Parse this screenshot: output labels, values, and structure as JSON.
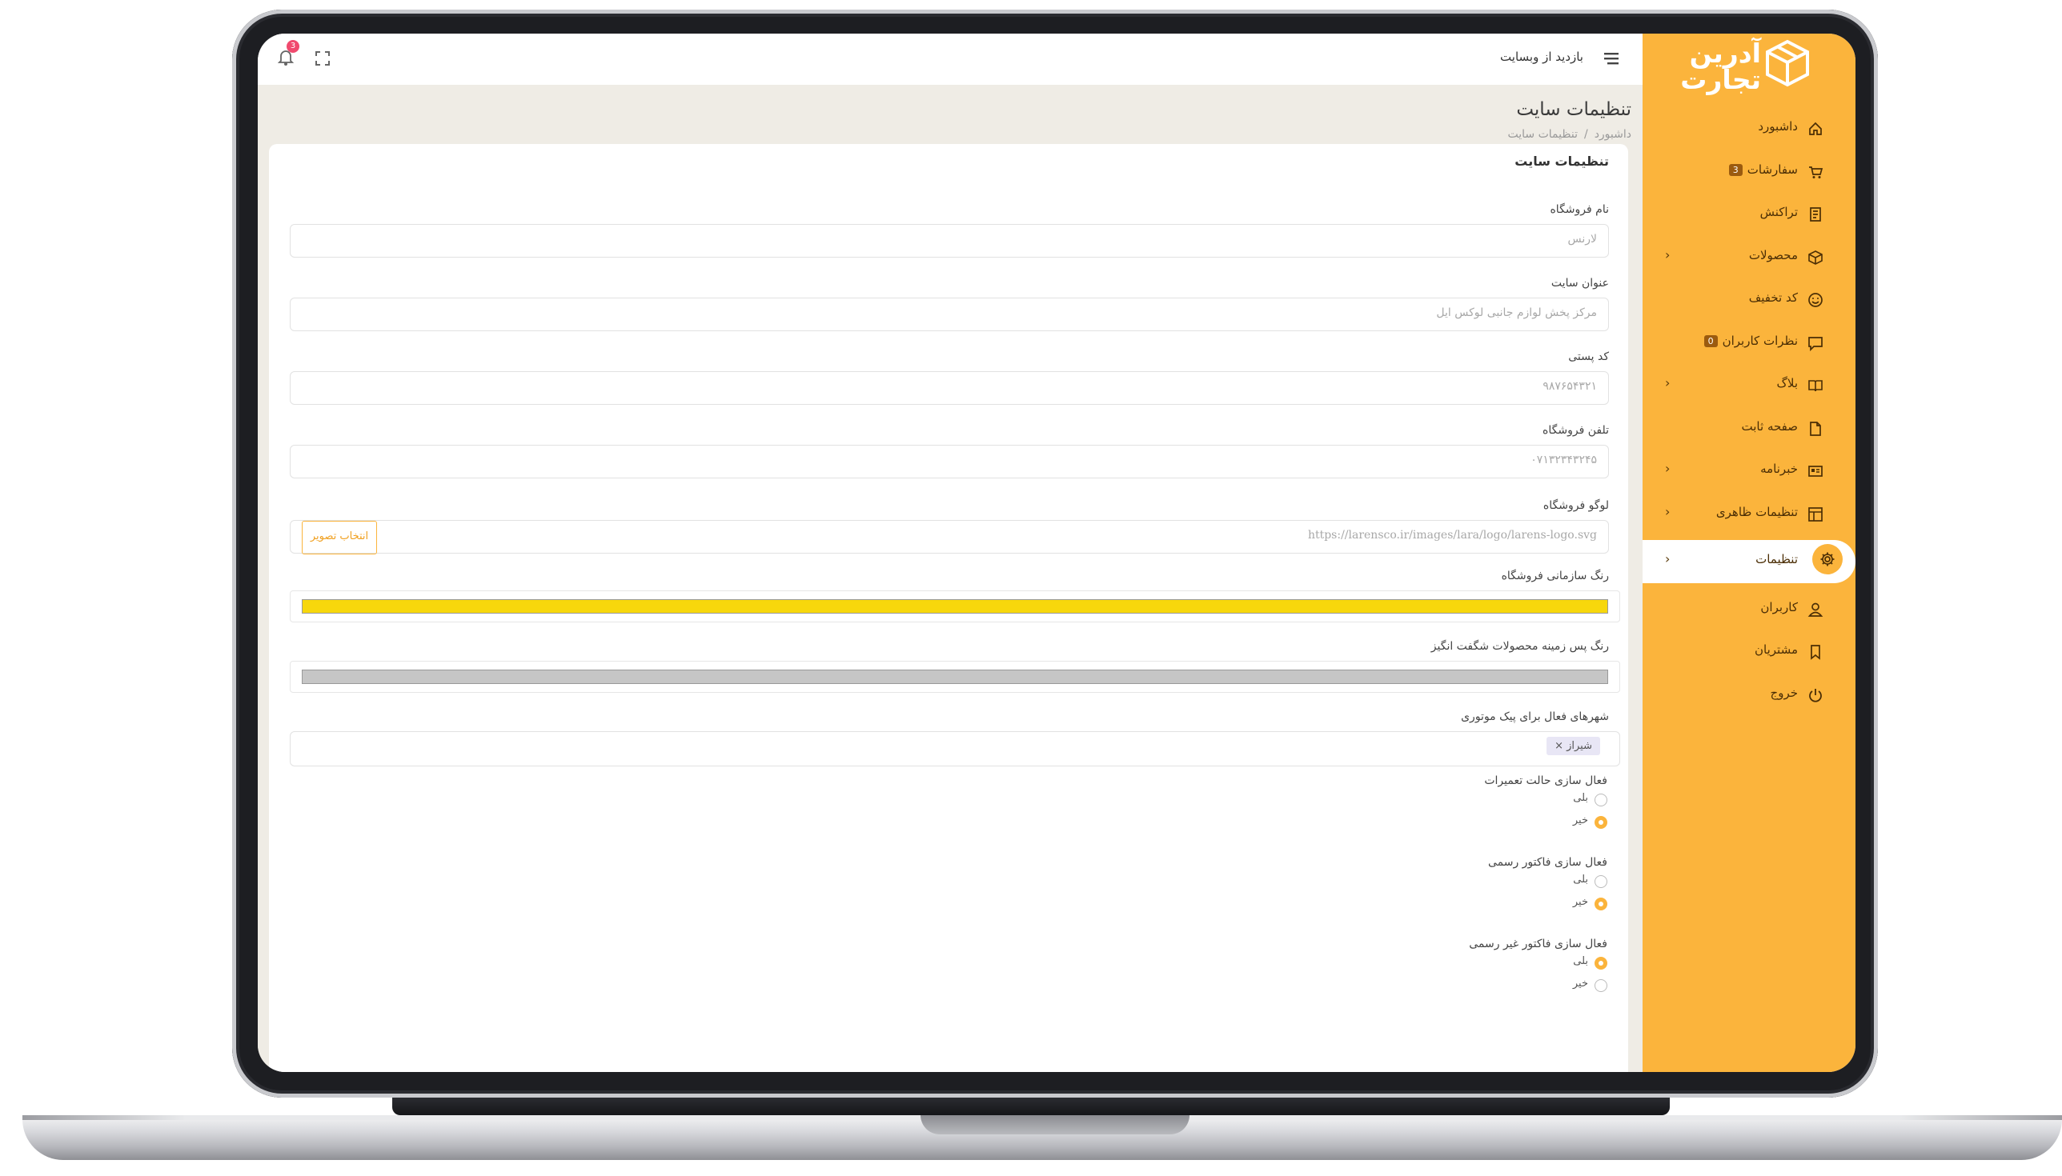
{
  "brand": {
    "name": "آدرین تجارت"
  },
  "topbar": {
    "visit_site": "بازدید از وبسایت",
    "notification_count": "3"
  },
  "sidebar": {
    "items": [
      {
        "label": "داشبورد",
        "icon": "home-icon"
      },
      {
        "label": "سفارشات",
        "icon": "cart-icon",
        "badge": "3"
      },
      {
        "label": "تراکنش",
        "icon": "receipt-icon"
      },
      {
        "label": "محصولات",
        "icon": "box-icon",
        "chevron": "‹"
      },
      {
        "label": "کد تخفیف",
        "icon": "smile-icon"
      },
      {
        "label": "نظرات کاربران",
        "icon": "comment-icon",
        "badge": "0"
      },
      {
        "label": "بلاگ",
        "icon": "book-icon",
        "chevron": "‹"
      },
      {
        "label": "صفحه ثابت",
        "icon": "file-icon"
      },
      {
        "label": "خبرنامه",
        "icon": "newsletter-icon",
        "chevron": "‹"
      },
      {
        "label": "تنظیمات ظاهری",
        "icon": "layout-icon",
        "chevron": "‹"
      },
      {
        "label": "تنظیمات",
        "icon": "gear-icon",
        "chevron": "‹",
        "active": true
      },
      {
        "label": "کاربران",
        "icon": "user-icon"
      },
      {
        "label": "مشتریان",
        "icon": "bookmark-icon"
      },
      {
        "label": "خروج",
        "icon": "power-icon"
      }
    ]
  },
  "page": {
    "title": "تنظیمات سایت",
    "breadcrumb": {
      "home": "داشبورد",
      "separator": "/",
      "current": "تنظیمات سایت"
    }
  },
  "form": {
    "card_title": "تنظیمات سایت",
    "store_name": {
      "label": "نام فروشگاه",
      "value": "لارنس"
    },
    "site_title": {
      "label": "عنوان سایت",
      "value": "مرکز پخش لوازم جانبی لوکس ایل"
    },
    "postal_code": {
      "label": "کد پستی",
      "value": "۹۸۷۶۵۴۳۲۱"
    },
    "store_phone": {
      "label": "تلفن فروشگاه",
      "value": "۰۷۱۳۲۳۴۳۲۴۵"
    },
    "store_logo": {
      "label": "لوگو فروشگاه",
      "value": "https://larensco.ir/images/lara/logo/larens-logo.svg",
      "button": "انتخاب تصویر"
    },
    "brand_color": {
      "label": "رنگ سازمانی فروشگاه",
      "color": "#f7d70c"
    },
    "amazing_bg_color": {
      "label": "رنگ پس زمینه محصولات شگفت انگیز",
      "color": "#c6c6c6"
    },
    "courier_cities": {
      "label": "شهرهای فعال برای پیک موتوری",
      "tags": [
        "شیراز ×"
      ]
    },
    "maintenance": {
      "label": "فعال سازی حالت تعمیرات",
      "yes": "بلی",
      "no": "خیر",
      "selected": "no"
    },
    "official_invoice": {
      "label": "فعال سازی فاکتور رسمی",
      "yes": "بلی",
      "no": "خیر",
      "selected": "no"
    },
    "unofficial_invoice": {
      "label": "فعال سازی فاکتور غیر رسمی",
      "yes": "بلی",
      "no": "خیر",
      "selected": "yes"
    }
  },
  "colors": {
    "accent": "#fbb43c",
    "brand_yellow": "#f7d70c",
    "badge_pink": "#f04a6e"
  }
}
